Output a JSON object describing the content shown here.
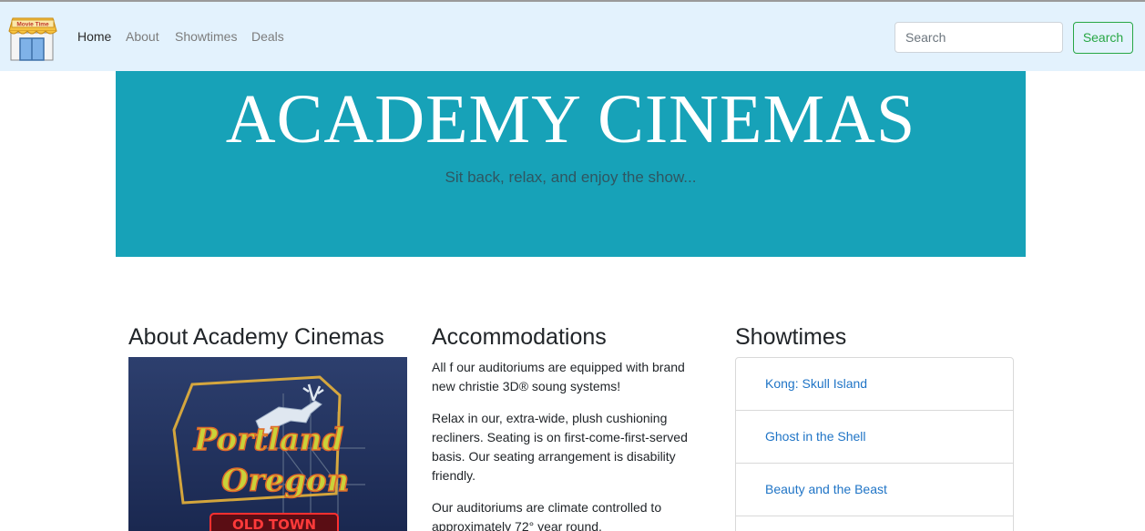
{
  "brand": {
    "logo_text": "Movie Time",
    "logo_icon": "storefront-icon"
  },
  "nav": {
    "items": [
      {
        "label": "Home",
        "active": true
      },
      {
        "label": "About",
        "active": false
      },
      {
        "label": "Showtimes",
        "active": false
      },
      {
        "label": "Deals",
        "active": false
      }
    ]
  },
  "search": {
    "placeholder": "Search",
    "button_label": "Search"
  },
  "hero": {
    "title": "ACADEMY CINEMAS",
    "subtitle": "Sit back, relax, and enjoy the show..."
  },
  "about": {
    "heading": "About Academy Cinemas",
    "image_sign_lines": [
      "Portland",
      "Oregon",
      "OLD TOWN"
    ]
  },
  "accommodations": {
    "heading": "Accommodations",
    "paragraphs": [
      "All f our auditoriums are equipped with brand new christie 3D® soung systems!",
      "Relax in our, extra-wide, plush cushioning recliners. Seating is on first-come-first-served basis. Our seating arrangement is disability friendly.",
      "Our auditoriums are climate controlled to approximately 72° year round."
    ]
  },
  "showtimes": {
    "heading": "Showtimes",
    "movies": [
      "Kong: Skull Island",
      "Ghost in the Shell",
      "Beauty and the Beast"
    ]
  },
  "colors": {
    "navbar_bg": "#e3f2fd",
    "hero_bg": "#17a2b8",
    "search_accent": "#28a745",
    "link": "#1f74c6"
  }
}
